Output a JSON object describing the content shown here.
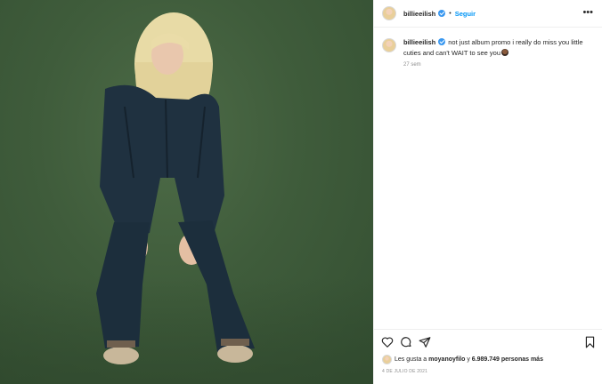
{
  "post": {
    "username": "billieeilish",
    "follow_label": "Seguir",
    "separator": "•",
    "more_label": "•••",
    "caption": "not just album promo i really do miss you little cuties and can't WAIT to see you",
    "time_ago": "27 sem",
    "likes_prefix": "Les gusta a",
    "likes_user": "moyanoyfilo",
    "likes_mid": "y",
    "likes_count": "6.989.749 personas más",
    "date": "4 DE JULIO DE 2021"
  },
  "icons": {
    "verified": "verified-badge-icon",
    "like": "heart-icon",
    "comment": "comment-icon",
    "share": "share-icon",
    "save": "bookmark-icon",
    "emoji": "emoji-icon"
  },
  "colors": {
    "background_green": "#3f5c3b",
    "accent_blue": "#0095f6",
    "verified_blue": "#3897f0",
    "text": "#262626",
    "muted": "#8e8e8e"
  }
}
